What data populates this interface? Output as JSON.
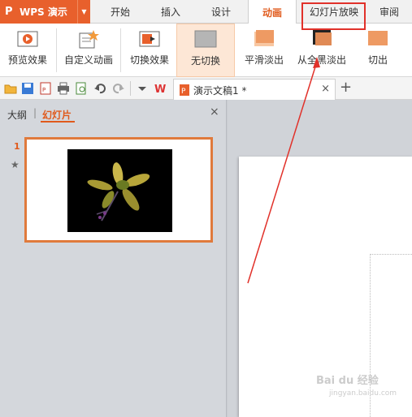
{
  "app": {
    "name": "WPS 演示",
    "logo": "P"
  },
  "menu": {
    "tabs": [
      "开始",
      "插入",
      "设计",
      "动画",
      "幻灯片放映",
      "审阅"
    ],
    "active_tab": "动画",
    "highlighted_tab": "幻灯片放映"
  },
  "ribbon": {
    "preview_label": "预览效果",
    "custom_anim_label": "自定义动画",
    "switch_effect_label": "切换效果",
    "no_switch_label": "无切换",
    "smooth_fade_label": "平滑淡出",
    "fade_black_label": "从全黑淡出",
    "cut_label": "切出"
  },
  "document_tab": {
    "title": "演示文稿1 *",
    "close": "×",
    "new": "+"
  },
  "left_panel": {
    "tab_outline": "大纲",
    "tab_separator": "|",
    "tab_slides": "幻灯片",
    "close": "×",
    "slide_number": "1",
    "slide_star": "★"
  },
  "watermark": {
    "brand": "Bai du 经验",
    "url": "jingyan.baidu.com"
  },
  "colors": {
    "accent": "#e8602c",
    "highlight_box": "#e1312a",
    "arrow": "#e1312a"
  }
}
